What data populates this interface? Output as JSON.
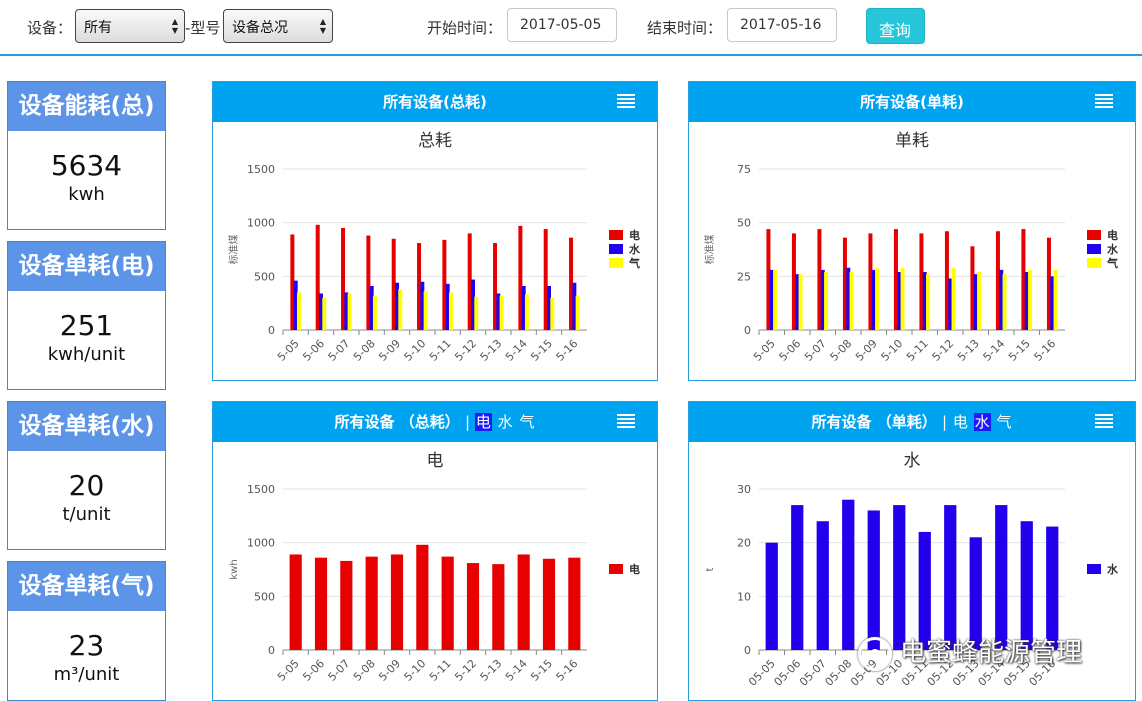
{
  "toolbar": {
    "device_label": "设备：",
    "device_value": "所有",
    "model_label": "-型号",
    "model_value": "设备总况",
    "start_label": "开始时间：",
    "start_value": "2017-05-05",
    "end_label": "结束时间：",
    "end_value": "2017-05-16",
    "query_label": "查询"
  },
  "metrics": [
    {
      "title": "设备能耗(总)",
      "value": "5634",
      "unit": "kwh"
    },
    {
      "title": "设备单耗(电)",
      "value": "251",
      "unit": "kwh/unit"
    },
    {
      "title": "设备单耗(水)",
      "value": "20",
      "unit": "t/unit"
    },
    {
      "title": "设备单耗(气)",
      "value": "23",
      "unit": "m³/unit"
    }
  ],
  "panels": [
    {
      "header": "所有设备(总耗)"
    },
    {
      "header": "所有设备(单耗)"
    },
    {
      "header": "所有设备 （总耗）",
      "selector": [
        "电",
        "水",
        "气"
      ],
      "selected": "电"
    },
    {
      "header": "所有设备 （单耗）",
      "selector": [
        "电",
        "水",
        "气"
      ],
      "selected": "水"
    }
  ],
  "watermark": "电蜜蜂能源管理",
  "colors": {
    "electric": "#e60000",
    "water": "#2200ee",
    "gas": "#ffff00",
    "header": "#00a3ef",
    "card": "#5c94e8"
  },
  "chart_data": [
    {
      "type": "bar",
      "title": "总耗",
      "ylabel": "标准煤",
      "ylim": [
        0,
        1500
      ],
      "yticks": [
        0,
        500,
        1000,
        1500
      ],
      "categories": [
        "5-05",
        "5-06",
        "5-07",
        "5-08",
        "5-09",
        "5-10",
        "5-11",
        "5-12",
        "5-13",
        "5-14",
        "5-15",
        "5-16"
      ],
      "series": [
        {
          "name": "电",
          "color": "#e60000",
          "values": [
            890,
            980,
            950,
            880,
            850,
            810,
            840,
            900,
            810,
            970,
            940,
            860
          ]
        },
        {
          "name": "水",
          "color": "#2200ee",
          "values": [
            460,
            340,
            350,
            410,
            440,
            450,
            430,
            470,
            340,
            410,
            410,
            440
          ]
        },
        {
          "name": "气",
          "color": "#ffff00",
          "values": [
            350,
            300,
            340,
            320,
            380,
            360,
            350,
            310,
            320,
            330,
            300,
            320
          ]
        }
      ],
      "legend": "right"
    },
    {
      "type": "bar",
      "title": "单耗",
      "ylabel": "标准煤",
      "ylim": [
        0,
        75
      ],
      "yticks": [
        0,
        25,
        50,
        75
      ],
      "categories": [
        "5-05",
        "5-06",
        "5-07",
        "5-08",
        "5-09",
        "5-10",
        "5-11",
        "5-12",
        "5-13",
        "5-14",
        "5-15",
        "5-16"
      ],
      "series": [
        {
          "name": "电",
          "color": "#e60000",
          "values": [
            47,
            45,
            47,
            43,
            45,
            47,
            45,
            46,
            39,
            46,
            47,
            43
          ]
        },
        {
          "name": "水",
          "color": "#2200ee",
          "values": [
            28,
            26,
            28,
            29,
            28,
            27,
            27,
            24,
            26,
            28,
            27,
            25
          ]
        },
        {
          "name": "气",
          "color": "#ffff00",
          "values": [
            28,
            26,
            27,
            27,
            29,
            29,
            26,
            29,
            27,
            26,
            28,
            28
          ]
        }
      ],
      "legend": "right"
    },
    {
      "type": "bar",
      "title": "电",
      "ylabel": "kwh",
      "ylim": [
        0,
        1500
      ],
      "yticks": [
        0,
        500,
        1000,
        1500
      ],
      "categories": [
        "5-05",
        "5-06",
        "5-07",
        "5-08",
        "5-09",
        "5-10",
        "5-11",
        "5-12",
        "5-13",
        "5-14",
        "5-15",
        "5-16"
      ],
      "series": [
        {
          "name": "电",
          "color": "#e60000",
          "values": [
            890,
            860,
            830,
            870,
            890,
            980,
            870,
            810,
            800,
            890,
            850,
            860
          ]
        }
      ],
      "legend": "right"
    },
    {
      "type": "bar",
      "title": "水",
      "ylabel": "t",
      "ylim": [
        0,
        30
      ],
      "yticks": [
        0,
        10,
        20,
        30
      ],
      "categories": [
        "05-05",
        "05-06",
        "05-07",
        "05-08",
        "05-09",
        "05-10",
        "05-11",
        "05-12",
        "05-13",
        "05-14",
        "05-15",
        "05-16"
      ],
      "series": [
        {
          "name": "水",
          "color": "#2200ee",
          "values": [
            20,
            27,
            24,
            28,
            26,
            27,
            22,
            27,
            21,
            27,
            24,
            23
          ]
        }
      ],
      "legend": "right"
    }
  ]
}
